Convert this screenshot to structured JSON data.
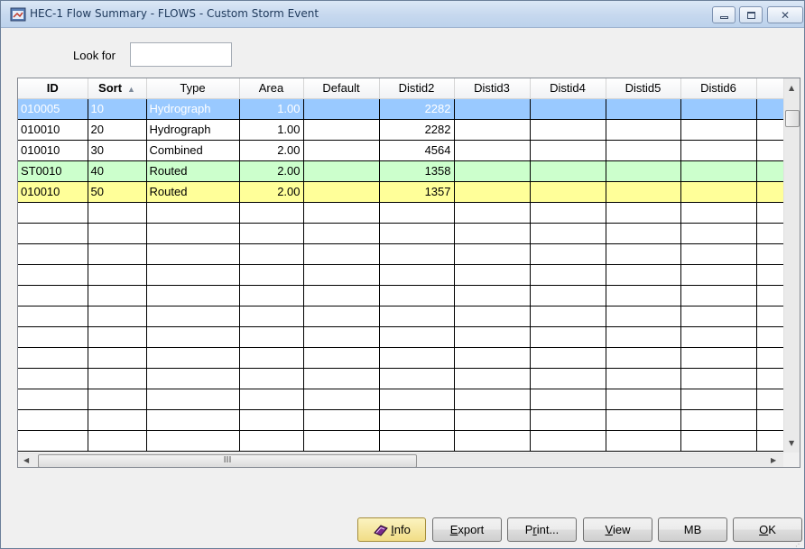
{
  "window": {
    "title": "HEC-1 Flow Summary - FLOWS - Custom Storm Event"
  },
  "search": {
    "label": "Look for",
    "value": ""
  },
  "grid": {
    "columns": [
      "ID",
      "Sort",
      "Type",
      "Area",
      "Default",
      "Distid2",
      "Distid3",
      "Distid4",
      "Distid5",
      "Distid6"
    ],
    "sort_column": "Sort",
    "sort_direction": "ascending",
    "rows": [
      {
        "id": "010005",
        "sort": "10",
        "type": "Hydrograph",
        "area": "1.00",
        "default": "",
        "distid2": "2282",
        "state": "selected"
      },
      {
        "id": "010010",
        "sort": "20",
        "type": "Hydrograph",
        "area": "1.00",
        "default": "",
        "distid2": "2282",
        "state": "normal"
      },
      {
        "id": "010010",
        "sort": "30",
        "type": "Combined",
        "area": "2.00",
        "default": "",
        "distid2": "4564",
        "state": "normal"
      },
      {
        "id": "ST0010",
        "sort": "40",
        "type": "Routed",
        "area": "2.00",
        "default": "",
        "distid2": "1358",
        "state": "green"
      },
      {
        "id": "010010",
        "sort": "50",
        "type": "Routed",
        "area": "2.00",
        "default": "",
        "distid2": "1357",
        "state": "yellow"
      }
    ],
    "row_colors": {
      "selected": "#99c9ff",
      "green": "#ccffcc",
      "yellow": "#ffff99"
    },
    "hscroll_grip": "III"
  },
  "buttons": {
    "info": {
      "accel": "I",
      "rest": "nfo"
    },
    "export": {
      "accel": "E",
      "rest": "xport"
    },
    "print": {
      "pre": "P",
      "accel": "r",
      "rest": "int..."
    },
    "view": {
      "accel": "V",
      "rest": "iew"
    },
    "mb": {
      "label": "MB"
    },
    "ok": {
      "accel": "O",
      "rest": "K"
    }
  },
  "icons": {
    "app": "app-icon",
    "minimize": "minimize-icon",
    "maximize": "maximize-icon",
    "close": "close-icon",
    "info": "book-icon"
  }
}
